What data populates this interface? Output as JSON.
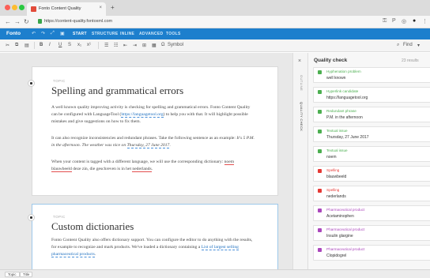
{
  "browser": {
    "tab_title": "Fonto Content Quality",
    "new_tab": "+",
    "url": "https://content-quality.fontoxml.com",
    "close_tab": "×"
  },
  "app": {
    "logo": "Fonto",
    "tabs": [
      "START",
      "STRUCTURE",
      "INLINE",
      "ADVANCED",
      "TOOLS"
    ],
    "active_tab": "START"
  },
  "toolbar": {
    "bold": "B",
    "italic": "I",
    "underline": "U",
    "strike": "S",
    "symbol": "Symbol",
    "find": "Find"
  },
  "editor": {
    "section1": {
      "topic_label": "TOPIC",
      "title": "Spelling and grammatical errors",
      "p1_a": "A well known quality improving activity is checking for spelling and grammatical errors. Fonto Content Quality can be configured with LanguageTool (",
      "p1_link": "https://languagetool.org",
      "p1_b": ") to help you with that. It will highlight possible mistakes and give suggestions on how to fix them.",
      "p2_a": "It can also recognize inconsistencies and redundant phrases. Take the following sentence as an example: ",
      "p2_em1": "It's 5 P.M. in the afternoon. The weather was nice on ",
      "p2_em2": "Thursday, 27 June 2017",
      "p2_end": ".",
      "p3_a": "When your content is tagged with a different language, we will use the corresponding dictionary: ",
      "p3_w1": "noem",
      "p3_w2": "blauwbeeld",
      "p3_mid": " deze zin, ",
      "p3_w3": "die",
      "p3_mid2": " geschreven is in het ",
      "p3_w4": "nederlands",
      "p3_end": "."
    },
    "section2": {
      "topic_label": "TOPIC",
      "title": "Custom dictionaries",
      "p1_a": "Fonto Content Quality also offers dictionary support. You can configure the editor to do anything with the results, for example to recognize and mark products. We've loaded a dictionary containing a ",
      "p1_link": "List of largest selling pharmaceutical products",
      "p1_end": "."
    }
  },
  "strip": {
    "close": "×",
    "label1": "OUTLINE",
    "label2": "QUALITY CHECK"
  },
  "quality": {
    "title": "Quality check",
    "count": "23 results",
    "items": [
      {
        "category": "Hyphenation problem",
        "value": "well known",
        "color": "#4caf50"
      },
      {
        "category": "Hyperlink candidate",
        "value": "https://languagetool.org",
        "color": "#4caf50"
      },
      {
        "category": "Redundant phrase",
        "value": "P.M. in the afternoon",
        "color": "#4caf50"
      },
      {
        "category": "Textual issue",
        "value": "Thursday, 27 June 2017",
        "color": "#4caf50"
      },
      {
        "category": "Textual issue",
        "value": "noem",
        "color": "#4caf50"
      },
      {
        "category": "Spelling",
        "value": "blauwbeeld",
        "color": "#e53935"
      },
      {
        "category": "Spelling",
        "value": "nederlands",
        "color": "#e53935"
      },
      {
        "category": "Pharmaceutical product",
        "value": "Acetaminophen",
        "color": "#ab47bc"
      },
      {
        "category": "Pharmaceutical product",
        "value": "Insulin glargine",
        "color": "#ab47bc"
      },
      {
        "category": "Pharmaceutical product",
        "value": "Clopidogrel",
        "color": "#ab47bc"
      }
    ]
  },
  "status": {
    "crumbs": [
      "Topic",
      "Title"
    ]
  }
}
